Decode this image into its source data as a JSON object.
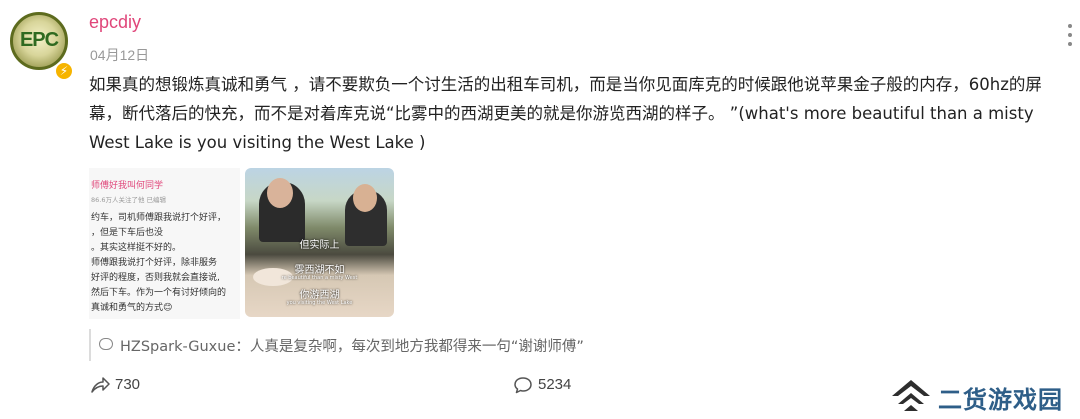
{
  "post": {
    "avatar_text": "EPC",
    "username": "epcdiy",
    "date": "04月12日",
    "content": "如果真的想锻炼真诚和勇气 ，请不要欺负一个讨生活的出租车司机，而是当你见面库克的时候跟他说苹果金子般的内存，60hz的屏幕，断代落后的快充，而不是对着库克说“比雾中的西湖更美的就是你游览西湖的样子。 ”(what's more beautiful than a misty West Lake is you visiting the West Lake )"
  },
  "image1": {
    "header": "师傅好我叫何同学",
    "subheader": "86.6万人关注了他  已编辑",
    "lines": [
      "约车，司机师傅跟我说打个好评，",
      "，但是下车后也没",
      "。其实这样挺不好的。",
      "师傅跟我说打个好评，除非服务",
      "好评的程度，否则我就会直接说,",
      "然后下车。作为一个有讨好倾向的",
      "真诚和勇气的方式😊"
    ]
  },
  "image2": {
    "caption1": "但实际上",
    "caption2": "雾西湖不如",
    "caption2_small": "re beautiful than a misty West",
    "caption3": "你游西湖",
    "caption3_small": "you visiting the West Lake"
  },
  "comment": {
    "text": "HZSpark-Guxue：人真是复杂啊，每次到地方我都得来一句“谢谢师傅”"
  },
  "actions": {
    "share_count": "730",
    "comment_count": "5234"
  },
  "watermark": {
    "text": "二货游戏园",
    "color": "#2e5e88"
  },
  "colors": {
    "username": "#e0467a",
    "badge": "#f6b400"
  }
}
